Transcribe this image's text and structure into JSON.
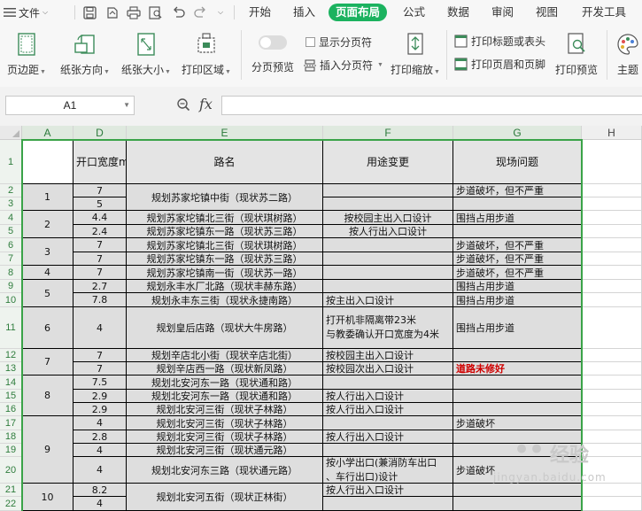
{
  "menu": {
    "file_label": "文件",
    "tabs": [
      "开始",
      "插入",
      "页面布局",
      "公式",
      "数据",
      "审阅",
      "视图",
      "开发工具"
    ],
    "active_tab": "页面布局"
  },
  "ribbon": {
    "margins": "页边距",
    "orientation": "纸张方向",
    "size": "纸张大小",
    "print_area": "打印区域",
    "page_break_preview": "分页预览",
    "show_page_breaks": "显示分页符",
    "insert_page_break": "插入分页符",
    "print_scaling": "打印缩放",
    "print_titles": "打印标题或表头",
    "print_header_footer": "打印页眉和页脚",
    "print_preview": "打印预览",
    "theme": "主题"
  },
  "formula_bar": {
    "name_box": "A1",
    "fx": "fx",
    "formula": ""
  },
  "columns": [
    "A",
    "D",
    "E",
    "F",
    "G",
    "H"
  ],
  "rows": [
    "1",
    "2",
    "3",
    "4",
    "5",
    "6",
    "7",
    "8",
    "9",
    "10",
    "11",
    "12",
    "13",
    "14",
    "15",
    "16",
    "17",
    "18",
    "19",
    "20",
    "21",
    "22"
  ],
  "sheet": {
    "headers": {
      "a": "",
      "d": "开口宽度m",
      "e": "路名",
      "f": "用途变更",
      "g": "现场问题"
    },
    "groups": [
      "1",
      "2",
      "3",
      "4",
      "5",
      "6",
      "7",
      "8",
      "9",
      "10"
    ],
    "d": [
      "7",
      "5",
      "4.4",
      "2.4",
      "7",
      "7",
      "7",
      "2.7",
      "7.8",
      "4",
      "7",
      "7",
      "7.5",
      "2.9",
      "2.9",
      "4",
      "2.8",
      "4",
      "4",
      "8.2",
      "4"
    ],
    "e": [
      "规划苏家坨镇中街（现状苏二路）",
      "规划苏家坨镇北三街（现状琪树路）",
      "规划苏家坨镇东一路（现状苏三路）",
      "规划苏家坨镇北三街（现状琪树路）",
      "规划苏家坨镇东一路（现状苏三路）",
      "规划苏家坨镇南一街（现状苏一路）",
      "规划永丰水厂北路（现状丰赫东路）",
      "规划永丰东三街（现状永捷南路）",
      "规划皇后店路（现状大牛房路）",
      "规划辛店北小街（现状辛店北街）",
      "规划辛店西一路（现状新凤路）",
      "规划北安河东一路（现状通和路）",
      "规划北安河东一路（现状通和路）",
      "规划北安河三街（现状子林路）",
      "规划北安河三街（现状子林路）",
      "规划北安河三街（现状子林路）",
      "规划北安河三街（现状通元路）",
      "规划北安河东三路（现状通元路）",
      "规划北安河五街（现状正林街）"
    ],
    "f": [
      "按校园主出入口设计",
      "按人行出入口设计",
      "按主出入口设计",
      "打开机非隔离带23米",
      "与教委确认开口宽度为4米",
      "按校园主出入口设计",
      "按校园次出入口设计",
      "按人行出入口设计",
      "按人行出入口设计",
      "按人行出入口设计",
      "按小学出口(兼消防车出口",
      "、车行出口)设计",
      "按人行出入口设计"
    ],
    "g": [
      "步道破坏，但不严重",
      "围挡占用步道",
      "步道破坏，但不严重",
      "步道破坏，但不严重",
      "步道破坏，但不严重",
      "围挡占用步道",
      "围挡占用步道",
      "围挡占用步道",
      "道路未修好",
      "步道破坏",
      "步道破坏"
    ]
  },
  "watermark": {
    "brand": "Baidu",
    "text": "经验",
    "url": "jingyan.baidu.com"
  }
}
